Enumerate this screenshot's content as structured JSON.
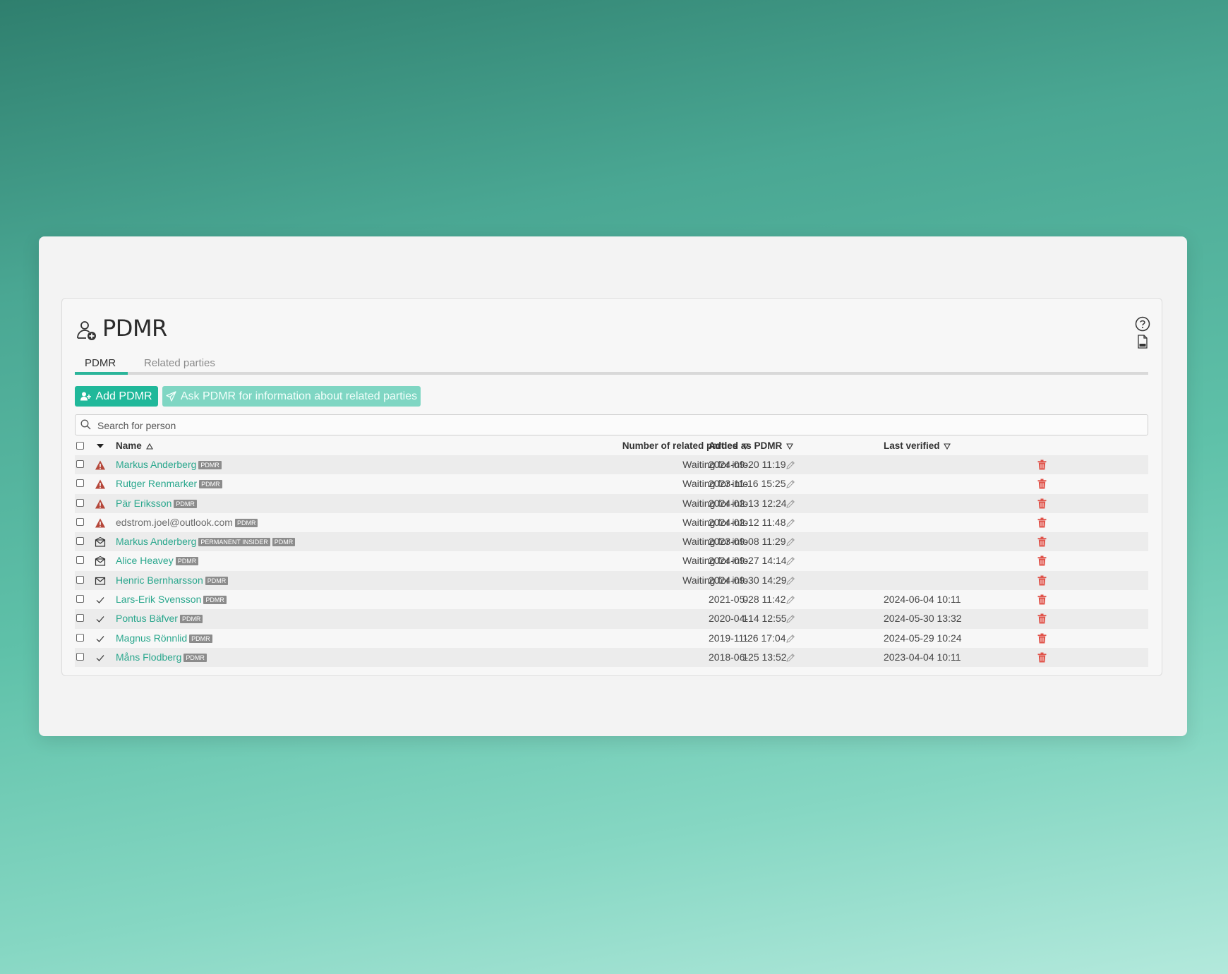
{
  "header": {
    "title": "PDMR"
  },
  "tabs": [
    {
      "label": "PDMR"
    },
    {
      "label": "Related parties"
    }
  ],
  "toolbar": {
    "add_label": "Add PDMR",
    "ask_label": "Ask PDMR for information about related parties"
  },
  "search": {
    "placeholder": "Search for person",
    "value": ""
  },
  "colors": {
    "accent": "#20b89a",
    "link": "#2aa78d",
    "warning": "#b5473a",
    "delete": "#e0534a"
  },
  "table": {
    "columns": {
      "name": "Name",
      "related": "Number of related parties",
      "added": "Added as PDMR",
      "verified": "Last verified"
    },
    "rows": [
      {
        "status": "warning-icon",
        "name": "Markus Anderberg",
        "is_link": true,
        "badges": [
          "PDMR"
        ],
        "related": "Waiting for info",
        "added": "2024-09-20 11:19",
        "verified": ""
      },
      {
        "status": "warning-icon",
        "name": "Rutger Renmarker",
        "is_link": true,
        "badges": [
          "PDMR"
        ],
        "related": "Waiting for info",
        "added": "2023-11-16 15:25",
        "verified": ""
      },
      {
        "status": "warning-icon",
        "name": "Pär Eriksson",
        "is_link": true,
        "badges": [
          "PDMR"
        ],
        "related": "Waiting for info",
        "added": "2024-02-13 12:24",
        "verified": ""
      },
      {
        "status": "warning-icon",
        "name": "edstrom.joel@outlook.com",
        "is_link": false,
        "badges": [
          "PDMR"
        ],
        "related": "Waiting for info",
        "added": "2024-02-12 11:48",
        "verified": ""
      },
      {
        "status": "envelope-open-icon",
        "name": "Markus Anderberg",
        "is_link": true,
        "badges": [
          "PERMANENT INSIDER",
          "PDMR"
        ],
        "related": "Waiting for info",
        "added": "2023-09-08 11:29",
        "verified": ""
      },
      {
        "status": "envelope-open-icon",
        "name": "Alice Heavey",
        "is_link": true,
        "badges": [
          "PDMR"
        ],
        "related": "Waiting for info",
        "added": "2024-09-27 14:14",
        "verified": ""
      },
      {
        "status": "envelope-icon",
        "name": "Henric Bernharsson",
        "is_link": true,
        "badges": [
          "PDMR"
        ],
        "related": "Waiting for info",
        "added": "2024-09-30 14:29",
        "verified": ""
      },
      {
        "status": "check-icon",
        "name": "Lars-Erik Svensson",
        "is_link": true,
        "badges": [
          "PDMR"
        ],
        "related": "0",
        "added": "2021-05-28 11:42",
        "verified": "2024-06-04 10:11"
      },
      {
        "status": "check-icon",
        "name": "Pontus Bäfver",
        "is_link": true,
        "badges": [
          "PDMR"
        ],
        "related": "1",
        "added": "2020-04-14 12:55",
        "verified": "2024-05-30 13:32"
      },
      {
        "status": "check-icon",
        "name": "Magnus Rönnlid",
        "is_link": true,
        "badges": [
          "PDMR"
        ],
        "related": "1",
        "added": "2019-11-26 17:04",
        "verified": "2024-05-29 10:24"
      },
      {
        "status": "check-icon",
        "name": "Måns Flodberg",
        "is_link": true,
        "badges": [
          "PDMR"
        ],
        "related": "1",
        "added": "2018-06-25 13:52",
        "verified": "2023-04-04 10:11"
      }
    ]
  }
}
